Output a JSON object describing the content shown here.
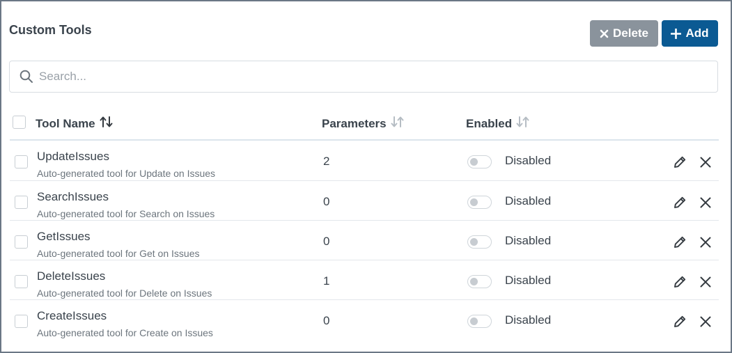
{
  "header": {
    "title": "Custom Tools",
    "delete_label": "Delete",
    "add_label": "Add"
  },
  "search": {
    "placeholder": "Search...",
    "value": ""
  },
  "table": {
    "columns": {
      "tool_name": "Tool Name",
      "parameters": "Parameters",
      "enabled": "Enabled"
    },
    "sort": {
      "tool_name": "ascending",
      "parameters": "none",
      "enabled": "none"
    },
    "rows": [
      {
        "name": "UpdateIssues",
        "description": "Auto-generated tool for Update on Issues",
        "parameters": "2",
        "enabled": false,
        "status": "Disabled"
      },
      {
        "name": "SearchIssues",
        "description": "Auto-generated tool for Search on Issues",
        "parameters": "0",
        "enabled": false,
        "status": "Disabled"
      },
      {
        "name": "GetIssues",
        "description": "Auto-generated tool for Get on Issues",
        "parameters": "0",
        "enabled": false,
        "status": "Disabled"
      },
      {
        "name": "DeleteIssues",
        "description": "Auto-generated tool for Delete on Issues",
        "parameters": "1",
        "enabled": false,
        "status": "Disabled"
      },
      {
        "name": "CreateIssues",
        "description": "Auto-generated tool for Create on Issues",
        "parameters": "0",
        "enabled": false,
        "status": "Disabled"
      }
    ]
  },
  "icons": {
    "delete_button": "close-icon",
    "add_button": "plus-icon",
    "search": "search-icon",
    "sort_tool_name": "sort-ascending-icon",
    "sort_parameters": "sort-icon",
    "sort_enabled": "sort-icon",
    "row_edit": "pencil-icon",
    "row_remove": "close-icon"
  },
  "colors": {
    "delete_button": "#8a939c",
    "add_button": "#0b5a93",
    "frame_border": "#6b7785"
  }
}
